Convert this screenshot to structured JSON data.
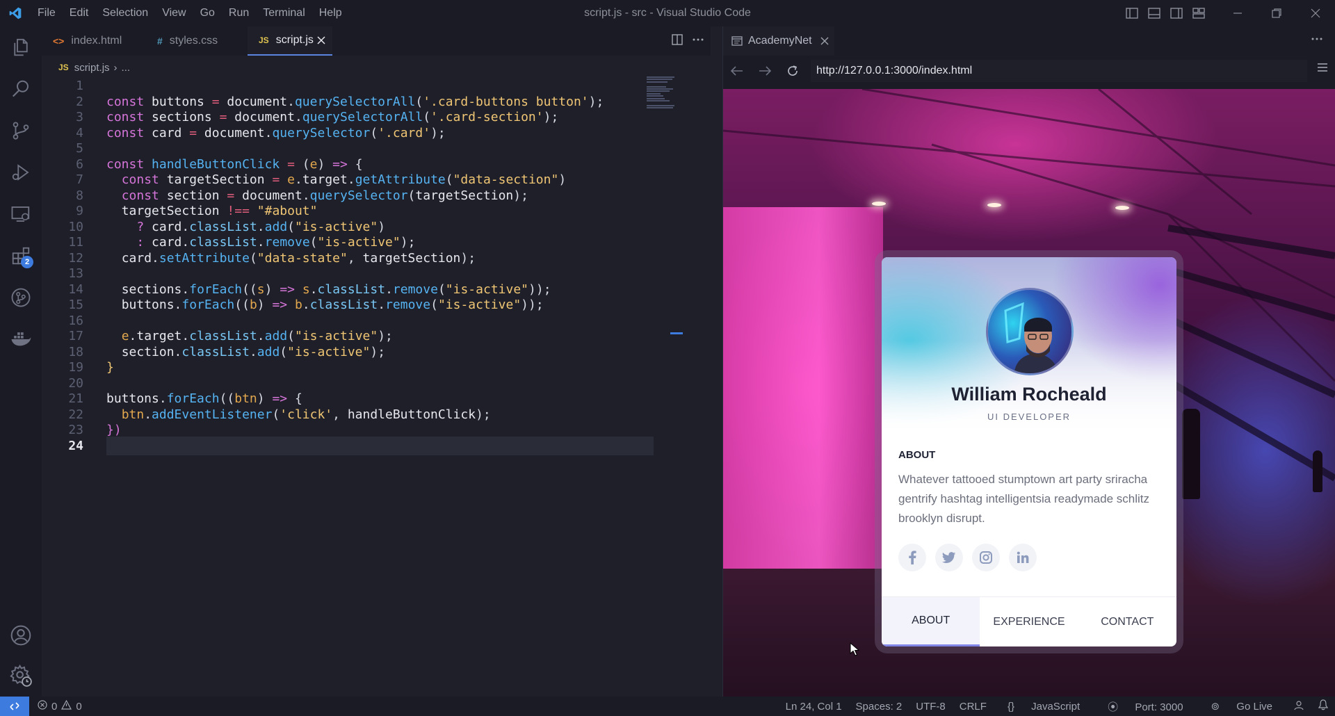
{
  "window": {
    "title": "script.js - src - Visual Studio Code",
    "menu": [
      "File",
      "Edit",
      "Selection",
      "View",
      "Go",
      "Run",
      "Terminal",
      "Help"
    ]
  },
  "activity": {
    "extensions_badge": "2"
  },
  "tabs": [
    {
      "label": "index.html",
      "icon": "<>",
      "color": "#e37933"
    },
    {
      "label": "styles.css",
      "icon": "#",
      "color": "#519aba"
    },
    {
      "label": "script.js",
      "icon": "JS",
      "color": "#e0c44f"
    }
  ],
  "breadcrumb": {
    "file": "script.js",
    "sep": "›",
    "rest": "..."
  },
  "code": {
    "cursor_line": "24",
    "lines": [
      {
        "n": "1",
        "html": ""
      },
      {
        "n": "2",
        "html": "<span class=\"k\">const</span> <span class=\"v\">buttons</span> <span class=\"o\">=</span> <span class=\"v\">document</span>.<span class=\"f\">querySelectorAll</span>(<span class=\"s\">'.card-buttons button'</span>);"
      },
      {
        "n": "3",
        "html": "<span class=\"k\">const</span> <span class=\"v\">sections</span> <span class=\"o\">=</span> <span class=\"v\">document</span>.<span class=\"f\">querySelectorAll</span>(<span class=\"s\">'.card-section'</span>);"
      },
      {
        "n": "4",
        "html": "<span class=\"k\">const</span> <span class=\"v\">card</span> <span class=\"o\">=</span> <span class=\"v\">document</span>.<span class=\"f\">querySelector</span>(<span class=\"s\">'.card'</span>);"
      },
      {
        "n": "5",
        "html": ""
      },
      {
        "n": "6",
        "html": "<span class=\"k\">const</span> <span class=\"f\">handleButtonClick</span> <span class=\"o\">=</span> (<span class=\"p\">e</span>) <span class=\"k\">=&gt;</span> {"
      },
      {
        "n": "7",
        "html": "  <span class=\"k\">const</span> <span class=\"v\">targetSection</span> <span class=\"o\">=</span> <span class=\"p\">e</span>.<span class=\"v\">target</span>.<span class=\"f\">getAttribute</span>(<span class=\"s\">\"data-section\"</span>)"
      },
      {
        "n": "8",
        "html": "  <span class=\"k\">const</span> <span class=\"v\">section</span> <span class=\"o\">=</span> <span class=\"v\">document</span>.<span class=\"f\">querySelector</span>(<span class=\"v\">targetSection</span>);"
      },
      {
        "n": "9",
        "html": "  <span class=\"v\">targetSection</span> <span class=\"o\">!==</span> <span class=\"s\">\"#about\"</span>"
      },
      {
        "n": "10",
        "html": "    <span class=\"k\">?</span> <span class=\"v\">card</span>.<span class=\"pr\">classList</span>.<span class=\"f\">add</span>(<span class=\"s\">\"is-active\"</span>)"
      },
      {
        "n": "11",
        "html": "    <span class=\"k\">:</span> <span class=\"v\">card</span>.<span class=\"pr\">classList</span>.<span class=\"f\">remove</span>(<span class=\"s\">\"is-active\"</span>);"
      },
      {
        "n": "12",
        "html": "  <span class=\"v\">card</span>.<span class=\"f\">setAttribute</span>(<span class=\"s\">\"data-state\"</span>, <span class=\"v\">targetSection</span>);"
      },
      {
        "n": "13",
        "html": ""
      },
      {
        "n": "14",
        "html": "  <span class=\"v\">sections</span>.<span class=\"f\">forEach</span>((<span class=\"p\">s</span>) <span class=\"k\">=&gt;</span> <span class=\"p\">s</span>.<span class=\"pr\">classList</span>.<span class=\"f\">remove</span>(<span class=\"s\">\"is-active\"</span>));"
      },
      {
        "n": "15",
        "html": "  <span class=\"v\">buttons</span>.<span class=\"f\">forEach</span>((<span class=\"p\">b</span>) <span class=\"k\">=&gt;</span> <span class=\"p\">b</span>.<span class=\"pr\">classList</span>.<span class=\"f\">remove</span>(<span class=\"s\">\"is-active\"</span>));"
      },
      {
        "n": "16",
        "html": ""
      },
      {
        "n": "17",
        "html": "  <span class=\"p\">e</span>.<span class=\"v\">target</span>.<span class=\"pr\">classList</span>.<span class=\"f\">add</span>(<span class=\"s\">\"is-active\"</span>);"
      },
      {
        "n": "18",
        "html": "  <span class=\"v\">section</span>.<span class=\"pr\">classList</span>.<span class=\"f\">add</span>(<span class=\"s\">\"is-active\"</span>);"
      },
      {
        "n": "19",
        "html": "<span class=\"s\">}</span>"
      },
      {
        "n": "20",
        "html": ""
      },
      {
        "n": "21",
        "html": "<span class=\"v\">buttons</span>.<span class=\"f\">forEach</span>((<span class=\"p\">btn</span>) <span class=\"k\">=&gt;</span> {"
      },
      {
        "n": "22",
        "html": "  <span class=\"p\">btn</span>.<span class=\"f\">addEventListener</span>(<span class=\"s\">'click'</span>, <span class=\"v\">handleButtonClick</span>);"
      },
      {
        "n": "23",
        "html": "<span class=\"k\">})</span>"
      },
      {
        "n": "24",
        "html": ""
      }
    ]
  },
  "browser": {
    "tab_label": "AcademyNet",
    "url": "http://127.0.0.1:3000/index.html"
  },
  "profile": {
    "name": "William Rocheald",
    "role": "UI DEVELOPER",
    "section_title": "ABOUT",
    "about": "Whatever tattooed stumptown art party sriracha gentrify hashtag intelligentsia readymade schlitz brooklyn disrupt.",
    "social": [
      "f",
      "t",
      "ig",
      "in"
    ],
    "buttons": [
      "ABOUT",
      "EXPERIENCE",
      "CONTACT"
    ],
    "active_button": "ABOUT"
  },
  "status": {
    "errors": "0",
    "warnings": "0",
    "position": "Ln 24, Col 1",
    "spaces": "Spaces: 2",
    "encoding": "UTF-8",
    "eol": "CRLF",
    "language": "JavaScript",
    "port": "Port: 3000",
    "live": "Go Live"
  },
  "colors": {
    "accent": "#3d7bde",
    "bg": "#1e1f29",
    "chrome": "#1a1b24"
  }
}
